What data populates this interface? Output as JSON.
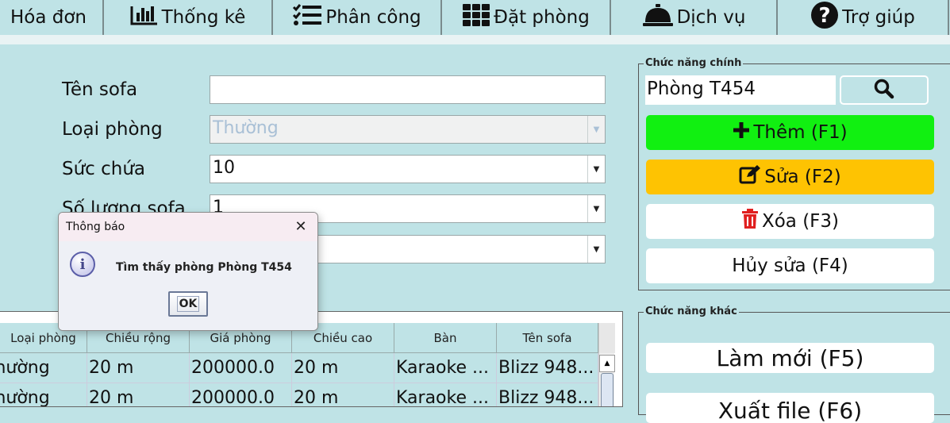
{
  "nav": {
    "items": [
      {
        "label": "Hóa đơn",
        "icon": "invoice-icon"
      },
      {
        "label": "Thống kê",
        "icon": "bar-chart-icon"
      },
      {
        "label": "Phân công",
        "icon": "checklist-icon"
      },
      {
        "label": "Đặt phòng",
        "icon": "grid-icon"
      },
      {
        "label": "Dịch vụ",
        "icon": "service-bell-icon"
      },
      {
        "label": "Trợ giúp",
        "icon": "help-icon"
      }
    ]
  },
  "form": {
    "sofa_name_label": "Tên sofa",
    "sofa_name_value": "",
    "room_type_label": "Loại phòng",
    "room_type_value": "Thường",
    "capacity_label": "Sức chứa",
    "capacity_value": "10",
    "sofa_count_label": "Số lượng sofa",
    "sofa_count_value": "1",
    "extra_value": ""
  },
  "main_functions": {
    "title": "Chức năng chính",
    "search_value": "Phòng T454",
    "add_label": "Thêm (F1)",
    "edit_label": "Sửa (F2)",
    "delete_label": "Xóa (F3)",
    "cancel_label": "Hủy sửa (F4)"
  },
  "other_functions": {
    "title": "Chức năng khác",
    "refresh_label": "Làm mới (F5)",
    "export_label": "Xuất file (F6)"
  },
  "table": {
    "columns": [
      "Loại phòng",
      "Chiều rộng",
      "Giá phòng",
      "Chiều cao",
      "Bàn",
      "Tên sofa"
    ],
    "rows": [
      [
        "Thường",
        "20 m",
        "200000.0",
        "20 m",
        "Karaoke ...",
        "Blizz 948..."
      ],
      [
        "Thường",
        "20 m",
        "200000.0",
        "20 m",
        "Karaoke ...",
        "Blizz 948..."
      ]
    ]
  },
  "dialog": {
    "title": "Thông báo",
    "message": "Tìm thấy phòng Phòng T454",
    "ok_label": "OK"
  },
  "colors": {
    "background": "#bfe3e6",
    "add_button": "#11f011",
    "edit_button": "#fec302",
    "delete_icon": "#e02020"
  }
}
